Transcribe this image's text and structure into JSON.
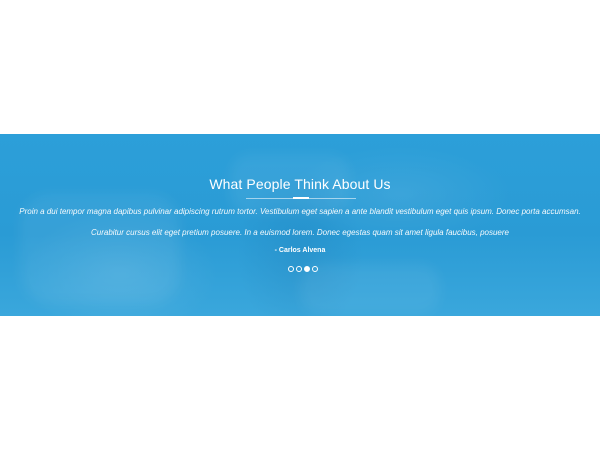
{
  "testimonials": {
    "title": "What People Think About Us",
    "quote_line_1": "Proin a dui tempor magna dapibus pulvinar adipiscing rutrum tortor. Vestibulum eget sapien a ante blandit vestibulum eget quis ipsum. Donec porta accumsan.",
    "quote_line_2": "Curabitur cursus elit eget pretium posuere. In a euismod lorem. Donec egestas quam sit amet ligula faucibus, posuere",
    "author": "- Carlos Alvena",
    "slides_total": 4,
    "active_slide": 3,
    "background_color": "#2b9fd8",
    "text_color": "#ffffff"
  }
}
